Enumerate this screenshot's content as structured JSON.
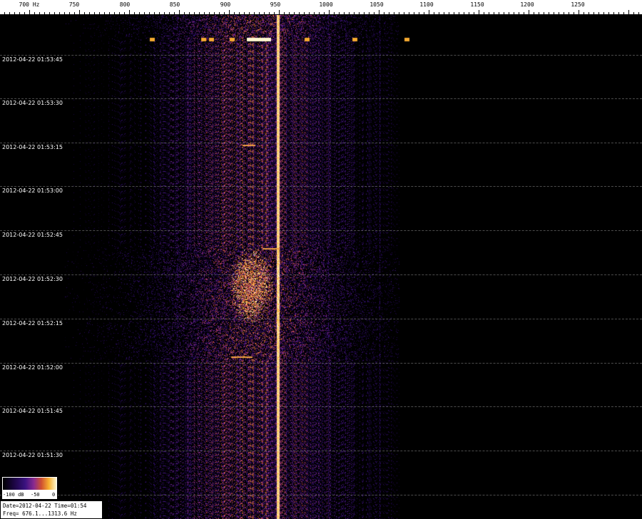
{
  "frequency_axis": {
    "unit_label": "Hz",
    "ticks": [
      "700",
      "750",
      "800",
      "850",
      "900",
      "950",
      "1000",
      "1050",
      "1100",
      "1150",
      "1200",
      "1250"
    ]
  },
  "time_axis": {
    "labels": [
      "2012-04-22 01:53:45",
      "2012-04-22 01:53:30",
      "2012-04-22 01:53:15",
      "2012-04-22 01:53:00",
      "2012-04-22 01:52:45",
      "2012-04-22 01:52:30",
      "2012-04-22 01:52:15",
      "2012-04-22 01:52:00",
      "2012-04-22 01:51:45",
      "2012-04-22 01:51:30"
    ]
  },
  "legend": {
    "labels": [
      "-100 dB",
      "-50",
      "0"
    ],
    "colors": [
      "#000000",
      "#1a0540",
      "#3a1280",
      "#8a2a90",
      "#d05030",
      "#f8b030",
      "#fff8d0"
    ]
  },
  "info": {
    "line1": "Date=2012-04-22 Time=01:54",
    "line2": "Freq= 676.1...1313.6 Hz"
  },
  "chart_data": {
    "type": "heatmap",
    "x_unit": "Hz",
    "x_range": [
      676.1,
      1313.6
    ],
    "carrier_frequency_hz": 952,
    "features": [
      {
        "kind": "steady carrier line",
        "frequency_hz": 952
      },
      {
        "kind": "bright burst cluster",
        "frequency_hz": [
          905,
          955
        ],
        "time": "2012-04-22 01:52:20 to 01:52:40"
      },
      {
        "kind": "sparse dots row",
        "frequency_hz": [
          800,
          1080
        ],
        "time": "near 2012-04-22 01:53:55"
      }
    ]
  }
}
